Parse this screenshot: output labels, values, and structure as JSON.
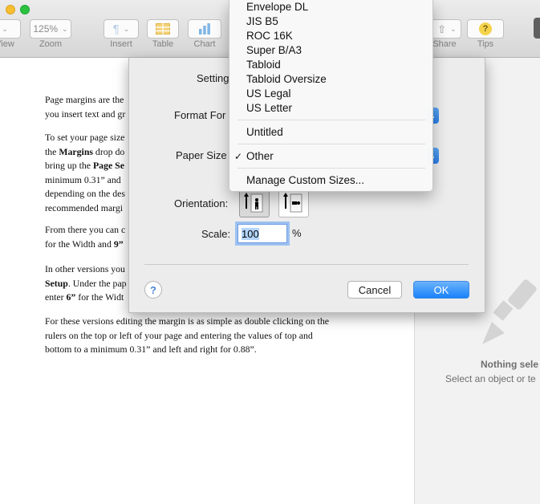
{
  "toolbar": {
    "view_label": "View",
    "zoom_value": "125%",
    "zoom_label": "Zoom",
    "insert_label": "Insert",
    "table_label": "Table",
    "chart_label": "Chart",
    "share_label": "Share",
    "tips_label": "Tips",
    "tips_icon": "?"
  },
  "document": {
    "p1": [
      "Page margins are the",
      "you insert text and gr"
    ],
    "p2": {
      "line1": "To set your page size",
      "line2_bold": "Margins",
      "line2_pre": "the ",
      "line2_post": " drop do",
      "line3_pre": "bring up the ",
      "line3_bold": "Page Se",
      "line4": "minimum 0.31” and",
      "line5": "depending on the des",
      "line6": "recommended margi"
    },
    "p3": {
      "line1": "From there you can c",
      "line2_pre": "for the Width and ",
      "line2_bold": "9”"
    },
    "p4": {
      "line1": "In other versions you",
      "line2_bold": "Setup",
      "line2_post": ". Under the pap",
      "line3_pre": "enter ",
      "line3_bold": "6”",
      "line3_post": " for the Widt"
    },
    "p5": [
      "For these versions editing the margin is as simple as double clicking on the",
      "rulers on the top or left of your page and entering the values of top and",
      "bottom to a minimum 0.31” and left and right for 0.88”."
    ]
  },
  "inspector": {
    "title": "Nothing sele",
    "subtitle": "Select an object or te"
  },
  "sheet": {
    "settings_label": "Setting",
    "format_label": "Format For",
    "paper_size_label": "Paper Size",
    "orientation_label": "Orientation:",
    "scale_label": "Scale:",
    "scale_value": "100",
    "scale_unit": "%",
    "help_label": "?",
    "cancel_label": "Cancel",
    "ok_label": "OK"
  },
  "menu": {
    "items": [
      "Envelope DL",
      "JIS B5",
      "ROC 16K",
      "Super B/A3",
      "Tabloid",
      "Tabloid Oversize",
      "US Legal",
      "US Letter"
    ],
    "untitled": "Untitled",
    "selected": "Other",
    "check_mark": "✓",
    "manage": "Manage Custom Sizes..."
  },
  "colors": {
    "accent": "#1a82fb",
    "focus_ring": "#9dc1f1"
  }
}
